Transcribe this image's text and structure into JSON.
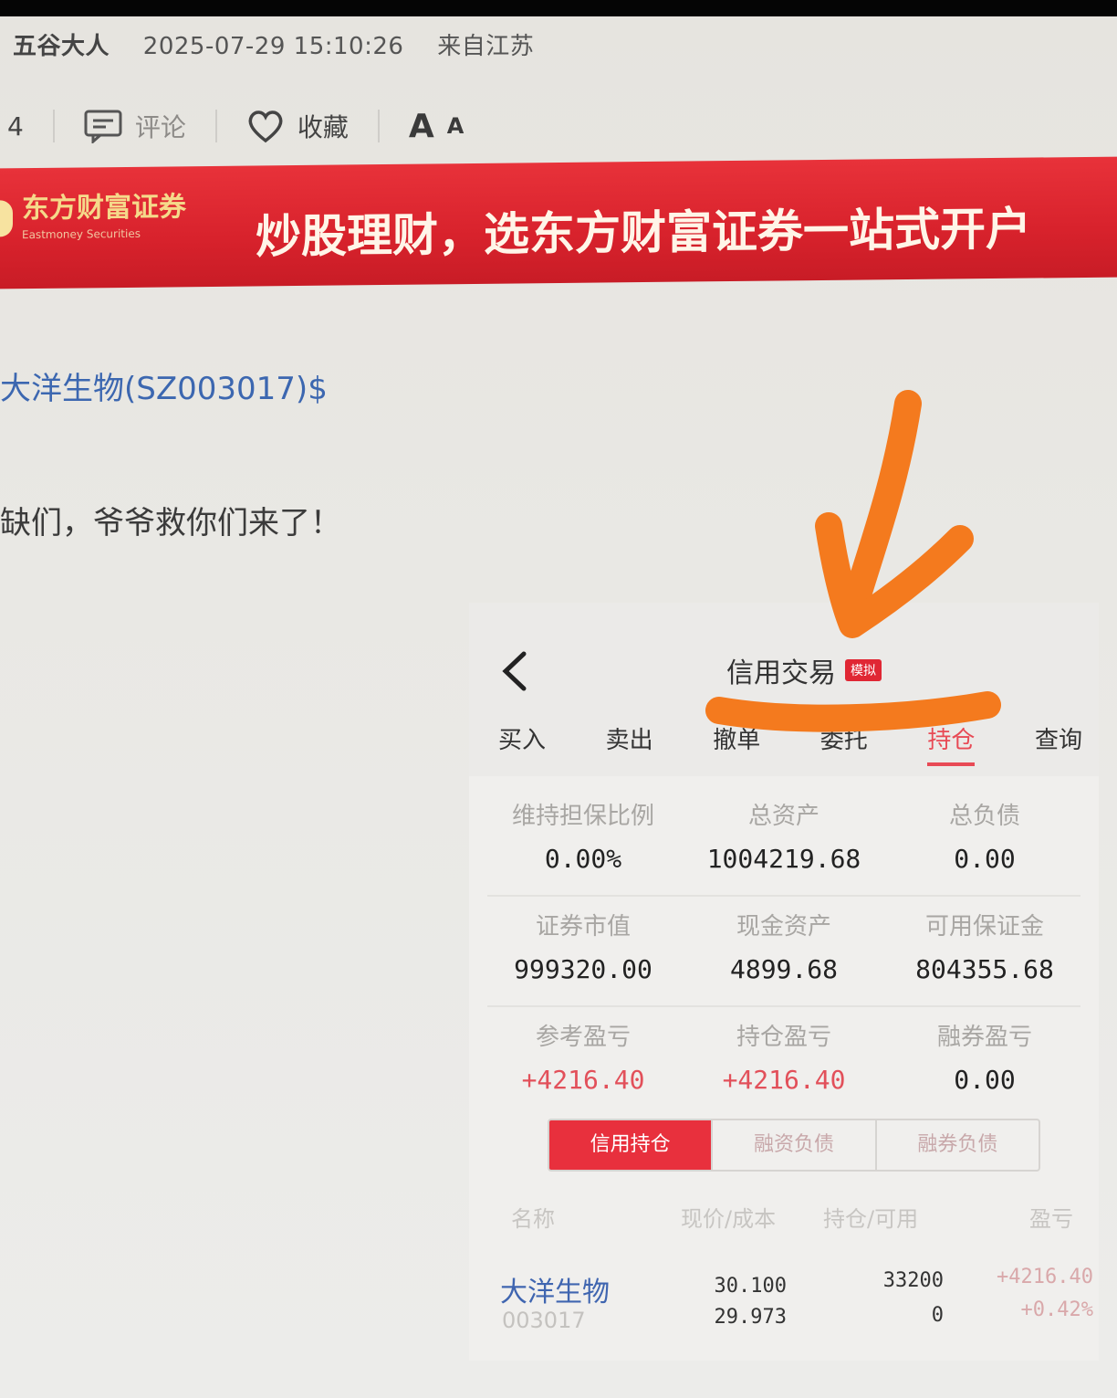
{
  "post_meta": {
    "author": "五谷大人",
    "datetime": "2025-07-29 15:10:26",
    "location": "来自江苏"
  },
  "actions": {
    "count": "4",
    "comment_label": "评论",
    "favorite_label": "收藏",
    "font_label_big": "A",
    "font_label_small": "A"
  },
  "banner": {
    "logo_text": "东方财富证券",
    "logo_sub": "Eastmoney Securities",
    "slogan": "炒股理财，选东方财富证券一站式开户",
    "bg_color": "#d8222c"
  },
  "post": {
    "stock_link": "大洋生物(SZ003017)$",
    "text": "缺们，爷爷救你们来了！"
  },
  "app": {
    "title": "信用交易",
    "badge": "模拟",
    "tabs": [
      "买入",
      "卖出",
      "撤单",
      "委托",
      "持仓",
      "查询"
    ],
    "active_tab": "持仓",
    "stats": [
      [
        {
          "label": "维持担保比例",
          "value": "0.00%"
        },
        {
          "label": "总资产",
          "value": "1004219.68"
        },
        {
          "label": "总负债",
          "value": "0.00"
        }
      ],
      [
        {
          "label": "证券市值",
          "value": "999320.00"
        },
        {
          "label": "现金资产",
          "value": "4899.68"
        },
        {
          "label": "可用保证金",
          "value": "804355.68"
        }
      ],
      [
        {
          "label": "参考盈亏",
          "value": "+4216.40"
        },
        {
          "label": "持仓盈亏",
          "value": "+4216.40"
        },
        {
          "label": "融券盈亏",
          "value": "0.00"
        }
      ]
    ],
    "segments": [
      "信用持仓",
      "融资负债",
      "融券负债"
    ],
    "table_headers": [
      "名称",
      "现价/成本",
      "持仓/可用",
      "盈亏"
    ],
    "positions": [
      {
        "name": "大洋生物",
        "code": "003017",
        "price": "30.100",
        "cost": "29.973",
        "holding": "33200",
        "available": "0",
        "pl": "+4216.40",
        "pl_pct": "+0.42%"
      }
    ],
    "accent_color": "#e8303d",
    "link_color": "#3f65b0"
  },
  "annotation_color": "#f47a1e"
}
